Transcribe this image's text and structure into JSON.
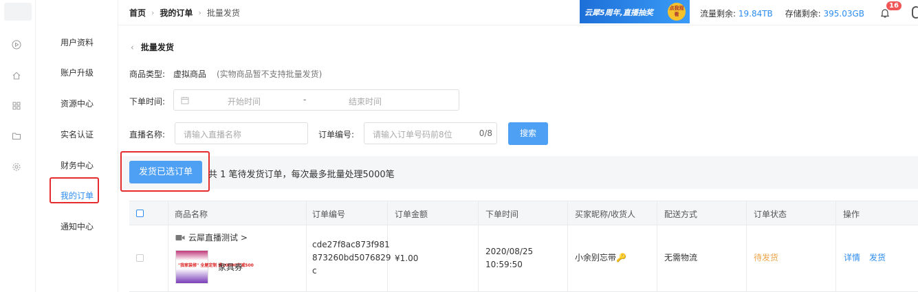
{
  "breadcrumb": {
    "home": "首页",
    "mid": "我的订单",
    "current": "批量发货"
  },
  "banner": {
    "text": "云犀5周年,直播抽奖",
    "badge": "点我观看"
  },
  "stats": {
    "traffic_label": "流量剩余:",
    "traffic_value": "19.84TB",
    "storage_label": "存储剩余:",
    "storage_value": "395.03GB"
  },
  "notifications": {
    "count": "16"
  },
  "rail_icons": [
    "play-icon",
    "home-icon",
    "grid-icon",
    "folder-icon",
    "gear-icon"
  ],
  "subnav": {
    "items": [
      {
        "label": "用户资料"
      },
      {
        "label": "账户升级"
      },
      {
        "label": "资源中心"
      },
      {
        "label": "实名认证"
      },
      {
        "label": "财务中心"
      },
      {
        "label": "我的订单"
      },
      {
        "label": "通知中心"
      }
    ],
    "active_index": 5
  },
  "page": {
    "back_title": "批量发货",
    "product_type_label": "商品类型:",
    "product_type_value": "虚拟商品",
    "product_type_note": "(实物商品暂不支持批量发货)",
    "order_time_label": "下单时间:",
    "start_placeholder": "开始时间",
    "range_sep": "-",
    "end_placeholder": "结束时间",
    "live_name_label": "直播名称:",
    "live_name_placeholder": "请输入直播名称",
    "order_no_label": "订单编号:",
    "order_no_placeholder": "请输入订单号码前8位",
    "order_no_count": "0/8",
    "search_button": "搜索",
    "ship_button": "发货已选订单",
    "ship_info": "共 1 笔待发货订单，每次最多批量处理5000笔"
  },
  "table": {
    "headers": [
      "商品名称",
      "订单编号",
      "订单金额",
      "下单时间",
      "买家昵称/收货人",
      "配送方式",
      "订单状态",
      "操作"
    ],
    "rows": [
      {
        "live_name": "云犀直播测试 >",
        "product_name": "家具券",
        "thumb_text": "\"我家装修\" 全屋定制 满10000立减500",
        "order_no": "cde27f8ac873f981873260bd5076829c",
        "amount": "¥1.00",
        "date": "2020/08/25",
        "time": "10:59:50",
        "buyer": "小余别忘带🔑",
        "delivery": "无需物流",
        "status": "待发货",
        "action_detail": "详情",
        "action_ship": "发货"
      }
    ]
  },
  "colors": {
    "accent": "#4ea0f5",
    "link": "#2d8cf0",
    "status_pending": "#f0a44a",
    "highlight_box": "#e52b2b"
  }
}
